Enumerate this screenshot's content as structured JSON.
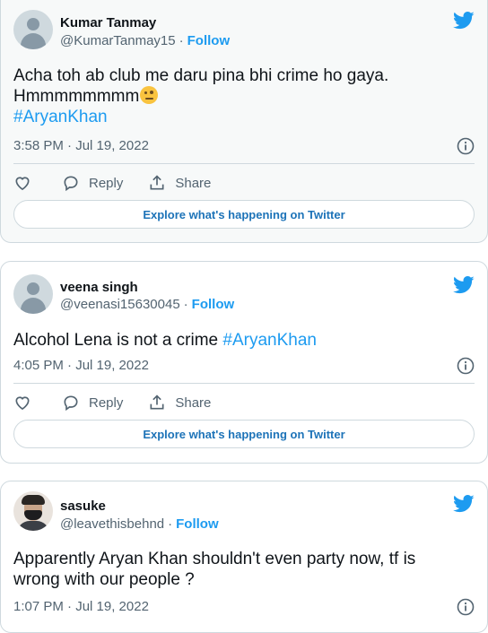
{
  "colors": {
    "accent": "#1d9bf0",
    "text": "#0f1419",
    "muted": "#536471",
    "border": "#cfd9de"
  },
  "tweets": [
    {
      "name": "Kumar Tanmay",
      "handle": "@KumarTanmay15",
      "follow": "Follow",
      "text_line1": "Acha toh ab club me daru pina bhi crime ho gaya.",
      "text_line2": "Hmmmmmmmm",
      "emoji": "face-with-raised-eyebrow",
      "hashtag": "#AryanKhan",
      "timestamp": "3:58 PM · Jul 19, 2022",
      "reply": "Reply",
      "share": "Share",
      "explore": "Explore what's happening on Twitter"
    },
    {
      "name": "veena singh",
      "handle": "@veenasi15630045",
      "follow": "Follow",
      "text": "Alcohol Lena is not a crime ",
      "hashtag": "#AryanKhan",
      "timestamp": "4:05 PM · Jul 19, 2022",
      "reply": "Reply",
      "share": "Share",
      "explore": "Explore what's happening on Twitter"
    },
    {
      "name": "sasuke",
      "handle": "@leavethisbehnd",
      "follow": "Follow",
      "text_line1": "Apparently Aryan Khan shouldn't even party now, tf is",
      "text_line2": "wrong with our people ?",
      "timestamp": "1:07 PM · Jul 19, 2022"
    }
  ],
  "separator": "·"
}
